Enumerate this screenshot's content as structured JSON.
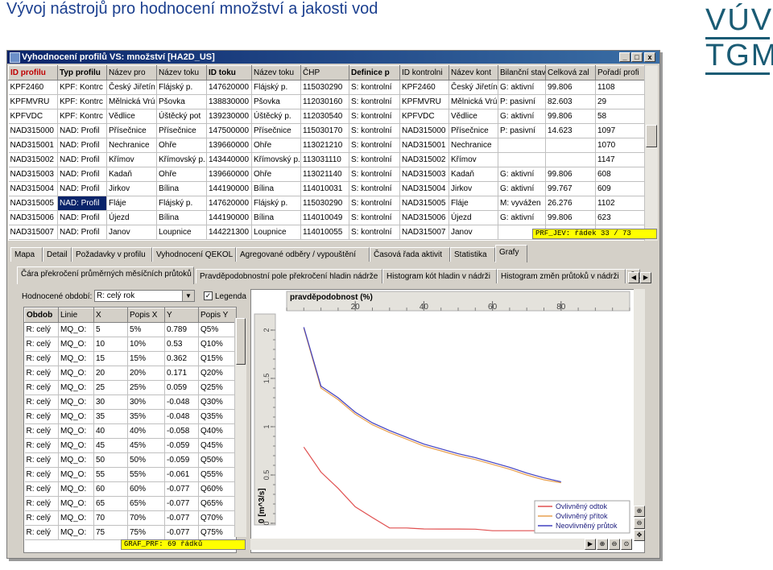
{
  "slide": {
    "title": "Vývoj nástrojů pro hodnocení množství a jakosti vod",
    "logo_top": "VÚV",
    "logo_bottom": "TGM"
  },
  "window": {
    "title": "Vyhodnocení profilů VS: množství [HA2D_US]",
    "buttons": [
      "_",
      "□",
      "x"
    ]
  },
  "top_grid": {
    "columns": [
      "ID profilu",
      "Typ profilu",
      "Název pro",
      "Název toku",
      "ID toku",
      "Název toku",
      "ČHP",
      "Definice p",
      "ID kontrolni",
      "Název kont",
      "Bilanční stav",
      "Celková zal",
      "Pořadí profi"
    ],
    "rows": [
      [
        "KPF2460",
        "KPF: Kontrc",
        "Český Jiřetín",
        "Flájský p.",
        "147620000",
        "Flájský p.",
        "115030290",
        "S: kontrolní",
        "KPF2460",
        "Český Jiřetín",
        "G: aktivní",
        "99.806",
        "1108"
      ],
      [
        "KPFMVRU",
        "KPF: Kontrc",
        "Mělnická Vrú",
        "Pšovka",
        "138830000",
        "Pšovka",
        "112030160",
        "S: kontrolní",
        "KPFMVRU",
        "Mělnická Vrú",
        "P: pasivní",
        "82.603",
        "29"
      ],
      [
        "KPFVDC",
        "KPF: Kontrc",
        "Vědlice",
        "Úštěcký pot",
        "139230000",
        "Úštěcký p.",
        "112030540",
        "S: kontrolní",
        "KPFVDC",
        "Vědlice",
        "G: aktivní",
        "99.806",
        "58"
      ],
      [
        "NAD315000",
        "NAD: Profil",
        "Přísečnice",
        "Přísečnice",
        "147500000",
        "Přísečnice",
        "115030170",
        "S: kontrolní",
        "NAD315000",
        "Přísečnice",
        "P: pasivní",
        "14.623",
        "1097"
      ],
      [
        "NAD315001",
        "NAD: Profil",
        "Nechranice",
        "Ohře",
        "139660000",
        "Ohře",
        "113021210",
        "S: kontrolní",
        "NAD315001",
        "Nechranice",
        "",
        "",
        "1070"
      ],
      [
        "NAD315002",
        "NAD: Profil",
        "Křímov",
        "Křímovský p.",
        "143440000",
        "Křímovský p.",
        "113031110",
        "S: kontrolní",
        "NAD315002",
        "Křímov",
        "",
        "",
        "1147"
      ],
      [
        "NAD315003",
        "NAD: Profil",
        "Kadaň",
        "Ohře",
        "139660000",
        "Ohře",
        "113021140",
        "S: kontrolní",
        "NAD315003",
        "Kadaň",
        "G: aktivní",
        "99.806",
        "608"
      ],
      [
        "NAD315004",
        "NAD: Profil",
        "Jirkov",
        "Bílina",
        "144190000",
        "Bílina",
        "114010031",
        "S: kontrolní",
        "NAD315004",
        "Jirkov",
        "G: aktivní",
        "99.767",
        "609"
      ],
      [
        "NAD315005",
        "NAD: Profil",
        "Fláje",
        "Flájský p.",
        "147620000",
        "Flájský p.",
        "115030290",
        "S: kontrolní",
        "NAD315005",
        "Fláje",
        "M: vyvážen",
        "26.276",
        "1102"
      ],
      [
        "NAD315006",
        "NAD: Profil",
        "Újezd",
        "Bílina",
        "144190000",
        "Bílina",
        "114010049",
        "S: kontrolní",
        "NAD315006",
        "Újezd",
        "G: aktivní",
        "99.806",
        "623"
      ],
      [
        "NAD315007",
        "NAD: Profil",
        "Janov",
        "Loupnice",
        "144221300",
        "Loupnice",
        "114010055",
        "S: kontrolní",
        "NAD315007",
        "Janov",
        "",
        "",
        ""
      ]
    ],
    "status": "PRF_JEV: řádek 33 / 73"
  },
  "tabs": [
    "Mapa",
    "Detail",
    "Požadavky v profilu",
    "Vyhodnocení QEKOL",
    "Agregované odběry / vypouštění",
    "Časová řada aktivit",
    "Statistika",
    "Grafy"
  ],
  "subtabs": [
    "Čára překročení průměrných měsíčních průtoků",
    "Pravděpodobnostní pole překročení hladin nádrže",
    "Histogram kót hladin v nádrži",
    "Histogram změn průtoků v nádrži",
    "Ča"
  ],
  "filter": {
    "label": "Hodnocené období:",
    "value": "R: celý rok",
    "legend_label": "Legenda",
    "legend_checked": "✓"
  },
  "bottom_grid": {
    "columns": [
      "Obdob",
      "Linie",
      "X",
      "Popis X",
      "Y",
      "Popis Y"
    ],
    "rows": [
      [
        "R: celý",
        "MQ_O:",
        "5",
        "5%",
        "0.789",
        "Q5%"
      ],
      [
        "R: celý",
        "MQ_O:",
        "10",
        "10%",
        "0.53",
        "Q10%"
      ],
      [
        "R: celý",
        "MQ_O:",
        "15",
        "15%",
        "0.362",
        "Q15%"
      ],
      [
        "R: celý",
        "MQ_O:",
        "20",
        "20%",
        "0.171",
        "Q20%"
      ],
      [
        "R: celý",
        "MQ_O:",
        "25",
        "25%",
        "0.059",
        "Q25%"
      ],
      [
        "R: celý",
        "MQ_O:",
        "30",
        "30%",
        "-0.048",
        "Q30%"
      ],
      [
        "R: celý",
        "MQ_O:",
        "35",
        "35%",
        "-0.048",
        "Q35%"
      ],
      [
        "R: celý",
        "MQ_O:",
        "40",
        "40%",
        "-0.058",
        "Q40%"
      ],
      [
        "R: celý",
        "MQ_O:",
        "45",
        "45%",
        "-0.059",
        "Q45%"
      ],
      [
        "R: celý",
        "MQ_O:",
        "50",
        "50%",
        "-0.059",
        "Q50%"
      ],
      [
        "R: celý",
        "MQ_O:",
        "55",
        "55%",
        "-0.061",
        "Q55%"
      ],
      [
        "R: celý",
        "MQ_O:",
        "60",
        "60%",
        "-0.077",
        "Q60%"
      ],
      [
        "R: celý",
        "MQ_O:",
        "65",
        "65%",
        "-0.077",
        "Q65%"
      ],
      [
        "R: celý",
        "MQ_O:",
        "70",
        "70%",
        "-0.077",
        "Q70%"
      ],
      [
        "R: celý",
        "MQ_O:",
        "75",
        "75%",
        "-0.077",
        "Q75%"
      ]
    ],
    "status": "GRAF_PRF: 69 řádků"
  },
  "chart_data": {
    "type": "line",
    "title": "",
    "xlabel": "pravděpodobnost (%)",
    "ylabel": "0 [m^3/s]",
    "xlim": [
      0,
      100
    ],
    "ylim": [
      0,
      2.1
    ],
    "xticks": [
      20,
      40,
      60,
      80
    ],
    "yticks": [
      0,
      0.5,
      1,
      1.5,
      2
    ],
    "ytick_labels": [
      "0",
      "0.5",
      "1",
      "1.5",
      "2"
    ],
    "series": [
      {
        "name": "Ovlivněný odtok",
        "color": "#e05050",
        "x": [
          5,
          10,
          15,
          20,
          25,
          30,
          35,
          40,
          45,
          50,
          55,
          60,
          65,
          70,
          75,
          80
        ],
        "y": [
          0.789,
          0.53,
          0.362,
          0.171,
          0.059,
          -0.048,
          -0.048,
          -0.058,
          -0.059,
          -0.059,
          -0.061,
          -0.077,
          -0.077,
          -0.077,
          -0.077,
          -0.077
        ]
      },
      {
        "name": "Ovlivněný přítok",
        "color": "#e8a050",
        "x": [
          5,
          10,
          15,
          20,
          25,
          30,
          35,
          40,
          45,
          50,
          55,
          60,
          65,
          70,
          75,
          80
        ],
        "y": [
          2.02,
          1.4,
          1.28,
          1.13,
          1.02,
          0.94,
          0.87,
          0.8,
          0.75,
          0.7,
          0.66,
          0.61,
          0.56,
          0.5,
          0.45,
          0.42
        ]
      },
      {
        "name": "Neovlivněný průtok",
        "color": "#4040c0",
        "x": [
          5,
          10,
          15,
          20,
          25,
          30,
          35,
          40,
          45,
          50,
          55,
          60,
          65,
          70,
          75,
          80
        ],
        "y": [
          2.03,
          1.42,
          1.3,
          1.15,
          1.04,
          0.96,
          0.89,
          0.82,
          0.77,
          0.72,
          0.68,
          0.63,
          0.58,
          0.52,
          0.47,
          0.43
        ]
      }
    ],
    "legend": "bottom-right"
  }
}
